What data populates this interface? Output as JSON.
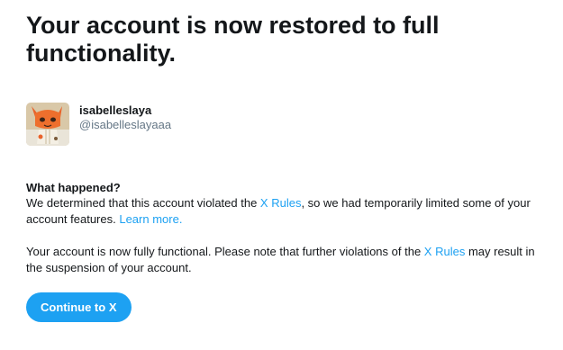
{
  "headline": "Your account is now restored to full functionality.",
  "profile": {
    "display_name": "isabelleslaya",
    "handle": "@isabelleslayaaa"
  },
  "what_happened": {
    "title": "What happened?",
    "text_before_link": "We determined that this account violated the ",
    "rules_link": "X Rules",
    "text_after_link": ", so we had temporarily limited some of your account features. ",
    "learn_more_link": "Learn more."
  },
  "status": {
    "text_before_link": "Your account is now fully functional. Please note that further violations of the ",
    "rules_link": "X Rules",
    "text_after_link": " may result in the suspension of your account."
  },
  "continue_button": "Continue to X",
  "colors": {
    "accent": "#1da1f2",
    "text": "#14171a",
    "muted": "#657786"
  }
}
